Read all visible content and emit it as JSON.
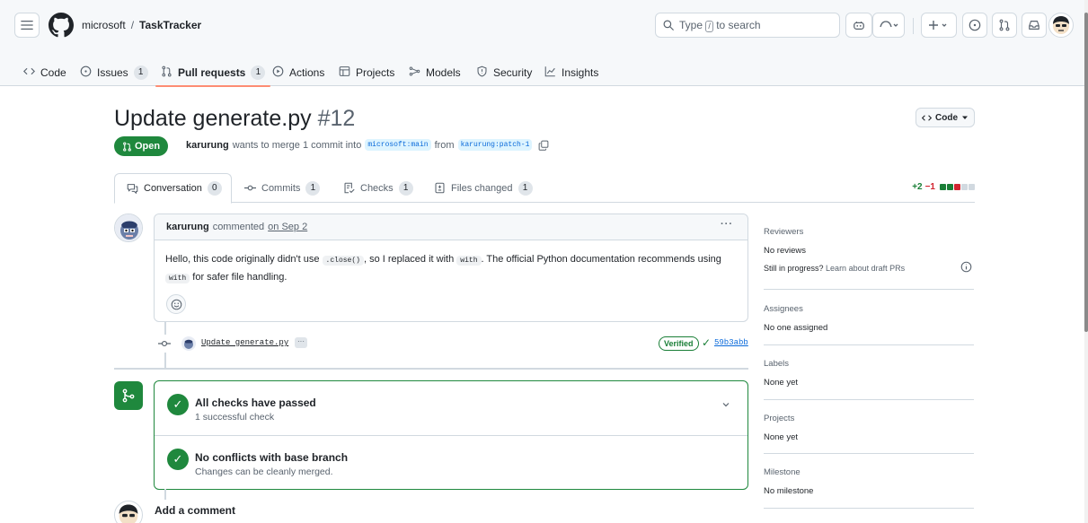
{
  "repo": {
    "owner": "microsoft",
    "separator": "/",
    "name": "TaskTracker"
  },
  "search": {
    "prefix": "Type",
    "key": "/",
    "suffix": "to search"
  },
  "topbar_icons": [
    "menu-icon",
    "github-logo-icon",
    "copilot-icon",
    "copilot-dropdown-icon",
    "plus-icon",
    "issues-icon",
    "pull-requests-icon",
    "inbox-icon",
    "user-avatar"
  ],
  "repo_tabs": [
    {
      "label": "Code",
      "icon": "code-icon"
    },
    {
      "label": "Issues",
      "icon": "issue-icon",
      "count": "1"
    },
    {
      "label": "Pull requests",
      "icon": "pull-request-icon",
      "count": "1",
      "active": true
    },
    {
      "label": "Actions",
      "icon": "play-icon"
    },
    {
      "label": "Projects",
      "icon": "table-icon"
    },
    {
      "label": "Models",
      "icon": "models-icon"
    },
    {
      "label": "Security",
      "icon": "shield-icon"
    },
    {
      "label": "Insights",
      "icon": "graph-icon"
    }
  ],
  "pr": {
    "title": "Update generate.py",
    "number": "#12",
    "code_button": "Code",
    "state": "Open",
    "author": "karurung",
    "merge_text_1": "wants to merge 1 commit into",
    "base_branch": "microsoft:main",
    "merge_text_2": "from",
    "head_branch": "karurung:patch-1"
  },
  "pr_tabs": [
    {
      "label": "Conversation",
      "count": "0",
      "icon": "comment-discussion-icon"
    },
    {
      "label": "Commits",
      "count": "1",
      "icon": "commit-icon"
    },
    {
      "label": "Checks",
      "count": "1",
      "icon": "checklist-icon"
    },
    {
      "label": "Files changed",
      "count": "1",
      "icon": "file-diff-icon"
    }
  ],
  "diffstat": {
    "additions": "+2",
    "deletions": "−1"
  },
  "comment": {
    "author": "karurung",
    "action": "commented",
    "when": "on Sep 2",
    "more": "···",
    "body_1": "Hello, this code originally didn't use",
    "code_1": ".close()",
    "body_2": ", so I replaced it with",
    "code_2": "with",
    "body_3": ". The official Python documentation recommends using",
    "code_3": "with",
    "body_4": "for safer file handling."
  },
  "commit": {
    "message": "Update generate.py",
    "ellipsis": "···",
    "verified": "Verified",
    "sha": "59b3abb"
  },
  "checks": {
    "status_title": "All checks have passed",
    "status_sub": "1 successful check",
    "conflict_title": "No conflicts with base branch",
    "conflict_sub": "Changes can be cleanly merged."
  },
  "add_comment": "Add a comment",
  "sidebar": {
    "reviewers_title": "Reviewers",
    "reviewers_value": "No reviews",
    "draft_note": "Still in progress?",
    "draft_link": "Learn about draft PRs",
    "assignees_title": "Assignees",
    "assignees_value": "No one assigned",
    "labels_title": "Labels",
    "labels_value": "None yet",
    "projects_title": "Projects",
    "projects_value": "None yet",
    "milestone_title": "Milestone",
    "milestone_value": "No milestone"
  },
  "colors": {
    "open_green": "#1f883d",
    "link_blue": "#0969da",
    "active_tab_underline": "#fd8c73",
    "diff_add": "#1a7f37",
    "diff_del": "#d1242f"
  }
}
